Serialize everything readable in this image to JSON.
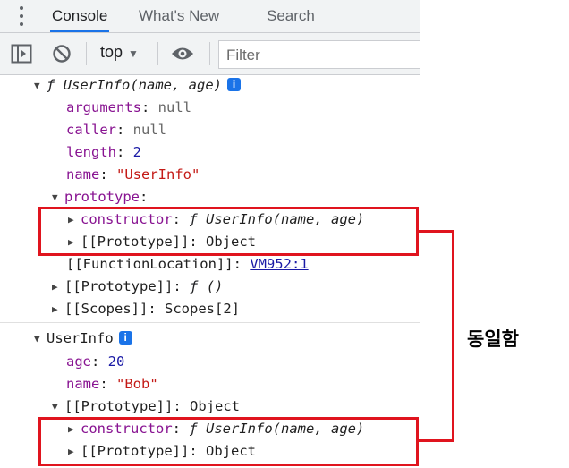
{
  "tabs": [
    {
      "label": "Console",
      "active": true
    },
    {
      "label": "What's New",
      "active": false
    },
    {
      "label": "Search",
      "active": false
    }
  ],
  "toolbar": {
    "context": "top",
    "filter_placeholder": "Filter"
  },
  "fn": {
    "f": "ƒ",
    "signature": "UserInfo(name, age)",
    "arguments_key": "arguments",
    "arguments_val": "null",
    "caller_key": "caller",
    "caller_val": "null",
    "length_key": "length",
    "length_val": "2",
    "name_key": "name",
    "name_val": "\"UserInfo\"",
    "prototype_key": "prototype",
    "proto_constructor_key": "constructor",
    "proto_constructor_sig": "UserInfo(name, age)",
    "proto_proto_key": "[[Prototype]]",
    "proto_proto_val": "Object",
    "fl_key": "[[FunctionLocation]]",
    "fl_val": "VM952:1",
    "pp_key": "[[Prototype]]",
    "pp_val": "()",
    "scopes_key": "[[Scopes]]",
    "scopes_val": "Scopes[2]"
  },
  "obj": {
    "title": "UserInfo",
    "age_key": "age",
    "age_val": "20",
    "name_key": "name",
    "name_val": "\"Bob\"",
    "proto_key": "[[Prototype]]",
    "proto_val": "Object",
    "constructor_key": "constructor",
    "constructor_sig": "UserInfo(name, age)",
    "proto_proto_key": "[[Prototype]]",
    "proto_proto_val": "Object"
  },
  "info_glyph": "i",
  "annotation": "동일함",
  "colors": {
    "highlight": "#e0141e",
    "accent": "#1a73e8",
    "key_purple": "#881391",
    "string_red": "#c41a16",
    "number_blue": "#1a1aa6"
  }
}
